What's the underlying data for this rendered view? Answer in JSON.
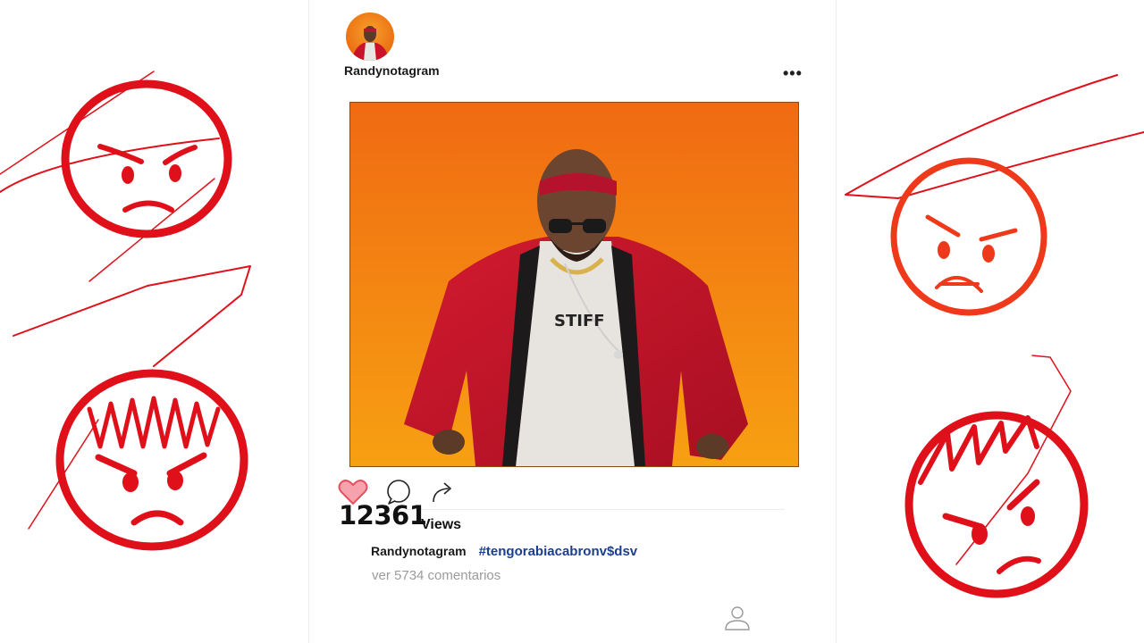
{
  "post": {
    "username": "Randynotagram",
    "more_label": "•••",
    "views_count": "12361",
    "views_label": "Views",
    "caption_username": "Randynotagram",
    "hashtag": "#tengorabiacabronv$dsv",
    "comments_link": "ver 5734 comentarios"
  },
  "icons": {
    "like": "heart-icon",
    "comment": "speech-bubble-icon",
    "share": "share-arrow-icon",
    "profile": "person-icon",
    "more": "more-dots-icon"
  },
  "colors": {
    "doodle_red": "#e0101a",
    "doodle_orange_red": "#ee3a1a",
    "heart_fill": "#f7a3ad",
    "heart_stroke": "#e8505f",
    "hashtag": "#1b3f8c",
    "photo_bg_top": "#f06a12",
    "photo_bg_bottom": "#f7a012"
  }
}
